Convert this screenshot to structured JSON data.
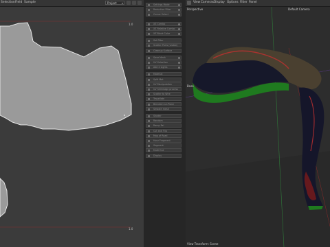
{
  "menubar": {
    "items": [
      "Selection",
      "Field",
      "Sample"
    ],
    "project_select": "Project"
  },
  "left_view": {
    "top_right_value": "1.0",
    "bottom_right_value": "1.0"
  },
  "node_panel": {
    "items": [
      "Settings Mode",
      "Reduction Filter",
      "Cursor Select",
      "",
      "",
      "XZ Combo",
      "XZ Relative Combo",
      "XZ Block Color",
      "",
      "Set Filter",
      "Scatter Ports (visible)",
      "Cleanup Surface",
      "",
      "Save Mesh",
      "UV Selection",
      "Add 4 Lights",
      "",
      "Material",
      "Split Mat",
      "UV Manipulation",
      "UV Shrinkage process",
      "Scatter to Wire",
      "Tessellate",
      "Blended cut-Plane",
      "Smooth mesh",
      "",
      "Shader",
      "Random",
      "Ramp Pal",
      "Cut and Flip",
      "Map of Road",
      "Hour Fragment",
      "Segment",
      "Multi End",
      "Display"
    ]
  },
  "viewport_3d": {
    "menu": [
      "View",
      "Cameras",
      "Display",
      "Options",
      "Filter",
      "Panel"
    ],
    "mode_label": "Perspective",
    "camera_label": "Default Camera",
    "origin_label": "Base",
    "footer_label": "View Transform: Scene"
  }
}
